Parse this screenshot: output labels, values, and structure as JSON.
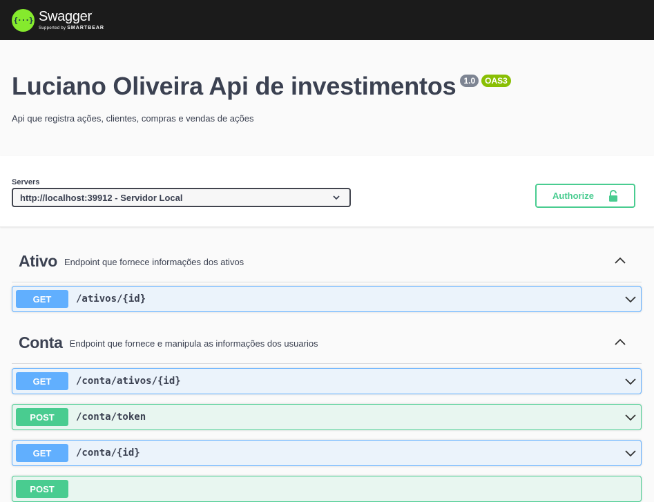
{
  "topbar": {
    "logo_mark": "{···}",
    "brand": "Swagger",
    "supported_by": "Supported by",
    "smartbear": "SMARTBEAR"
  },
  "info": {
    "title": "Luciano Oliveira Api de investimentos",
    "version": "1.0",
    "oas": "OAS3",
    "description": "Api que registra ações, clientes, compras e vendas de ações"
  },
  "servers": {
    "label": "Servers",
    "selected": "http://localhost:39912 - Servidor Local",
    "authorize_label": "Authorize"
  },
  "tags": [
    {
      "name": "Ativo",
      "description": "Endpoint que fornece informações dos ativos",
      "operations": [
        {
          "method": "GET",
          "path": "/ativos/{id}"
        }
      ]
    },
    {
      "name": "Conta",
      "description": "Endpoint que fornece e manipula as informações dos usuarios",
      "operations": [
        {
          "method": "GET",
          "path": "/conta/ativos/{id}"
        },
        {
          "method": "POST",
          "path": "/conta/token"
        },
        {
          "method": "GET",
          "path": "/conta/{id}"
        },
        {
          "method": "POST",
          "path": ""
        }
      ]
    }
  ],
  "colors": {
    "get": "#61affe",
    "post": "#49cc90",
    "topbar": "#1b1b1b",
    "logo": "#85ea2d"
  },
  "icons": {
    "select": "chevron-down-icon",
    "authorize": "unlocked-lock-icon",
    "tag_toggle": "chevron-up-icon",
    "operation": "chevron-down-icon"
  }
}
